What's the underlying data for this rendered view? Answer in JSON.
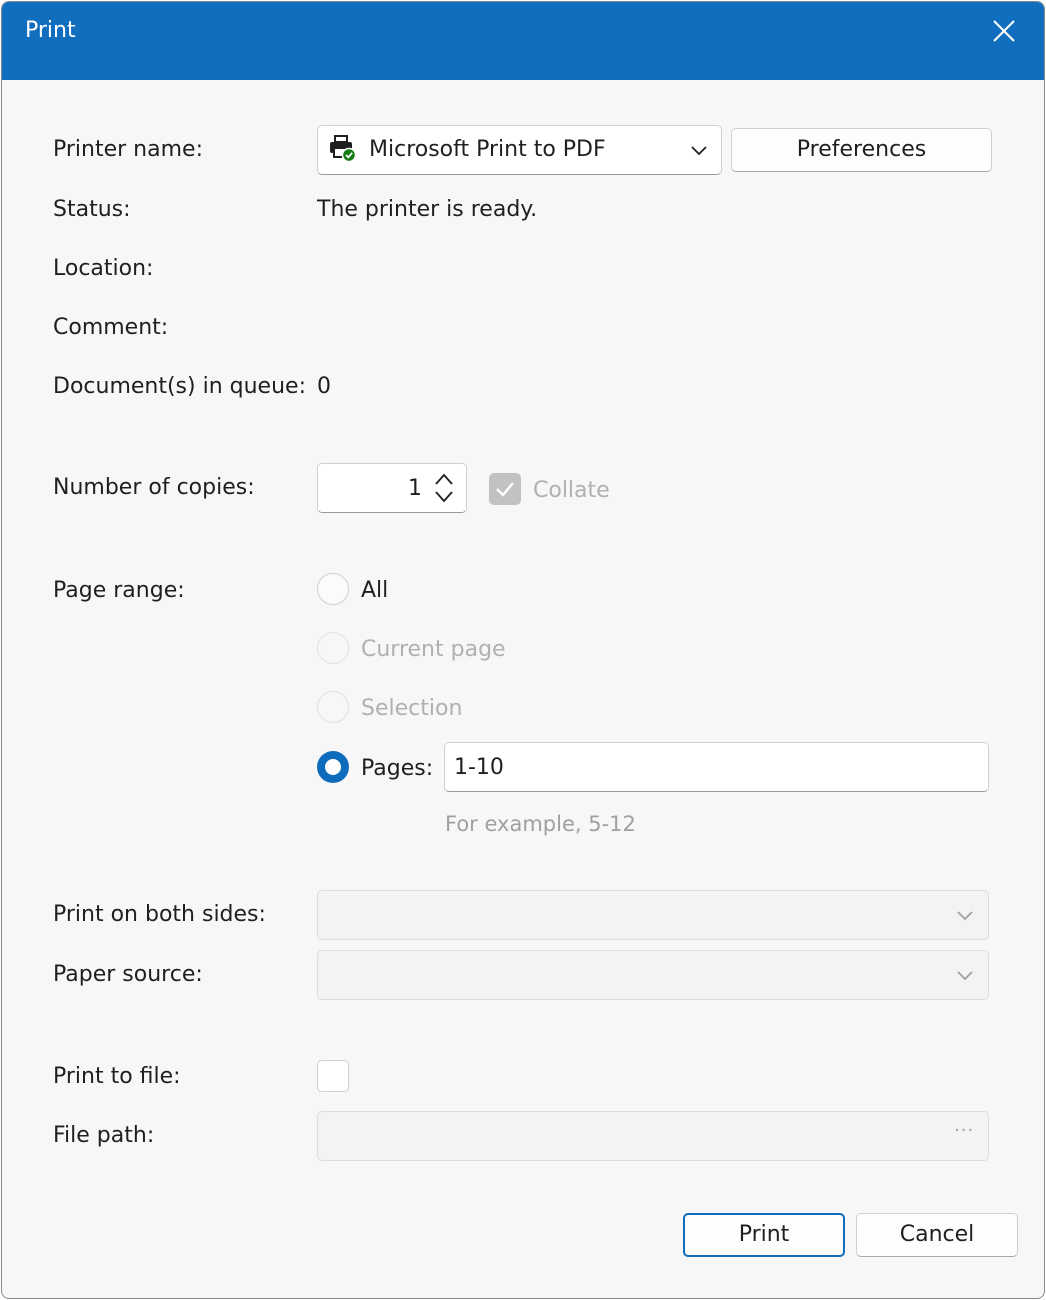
{
  "window": {
    "title": "Print"
  },
  "printer": {
    "name_label": "Printer name:",
    "selected_printer": "Microsoft Print to PDF",
    "preferences_label": "Preferences",
    "status_label": "Status:",
    "status_value": "The printer is ready.",
    "location_label": "Location:",
    "location_value": "",
    "comment_label": "Comment:",
    "comment_value": "",
    "queue_label": "Document(s) in queue:",
    "queue_value": "0"
  },
  "copies": {
    "label": "Number of copies:",
    "value": "1",
    "collate_label": "Collate",
    "collate_checked": true,
    "collate_enabled": false
  },
  "page_range": {
    "label": "Page range:",
    "options": [
      {
        "label": "All",
        "selected": false,
        "enabled": true
      },
      {
        "label": "Current page",
        "selected": false,
        "enabled": false
      },
      {
        "label": "Selection",
        "selected": false,
        "enabled": false
      },
      {
        "label": "Pages:",
        "selected": true,
        "enabled": true
      }
    ],
    "pages_value": "1-10",
    "hint": "For example, 5-12"
  },
  "duplex": {
    "label": "Print on both sides:",
    "value": ""
  },
  "paper_source": {
    "label": "Paper source:",
    "value": ""
  },
  "print_to_file": {
    "label": "Print to file:",
    "checked": false
  },
  "file_path": {
    "label": "File path:",
    "value": "",
    "browse_label": "···"
  },
  "footer": {
    "print_label": "Print",
    "cancel_label": "Cancel"
  },
  "colors": {
    "titlebar": "#116EBF",
    "accent": "#0F6CBD",
    "printer_status_ok": "#107C10"
  }
}
